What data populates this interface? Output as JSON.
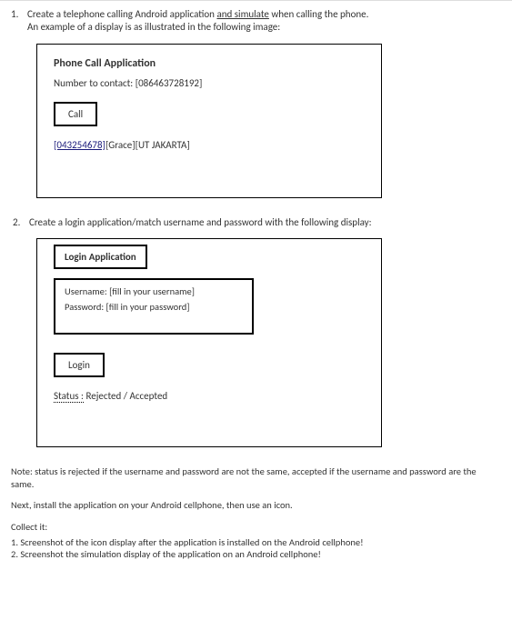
{
  "q1": {
    "number": "1.",
    "line1a": "Create a telephone calling Android application ",
    "line1b": "and  simulate",
    "line1c": " when calling the phone.",
    "line2": "An example of a display is as illustrated in the following image:",
    "mock": {
      "title": "Phone Call Application",
      "numberLabel": "Number to contact: [086463728192]",
      "callBtn": "Call",
      "resultLink": "[043254678]",
      "resultRest": "[Grace][UT JAKARTA]"
    }
  },
  "q2": {
    "number": "2.",
    "text": "Create a login application/match username and password with the following display:",
    "mock": {
      "title": "Login Application",
      "userLine": "Username: [fill in your username]",
      "passLine": "Password: [fill in your password]",
      "loginBtn": "Login",
      "statusLabel": "Status :",
      "statusValue": " Rejected / Accepted"
    }
  },
  "notes": {
    "note1": "Note: status is rejected if the username and password are not the same, accepted if the username and password are the same.",
    "note2": "Next, install the application on your Android cellphone, then use an icon.",
    "collectTitle": "Collect it:",
    "collect1": "1. Screenshot of the icon display after the application is installed on the Android cellphone!",
    "collect2": "2. Screenshot the simulation display of the application on an Android cellphone!"
  }
}
